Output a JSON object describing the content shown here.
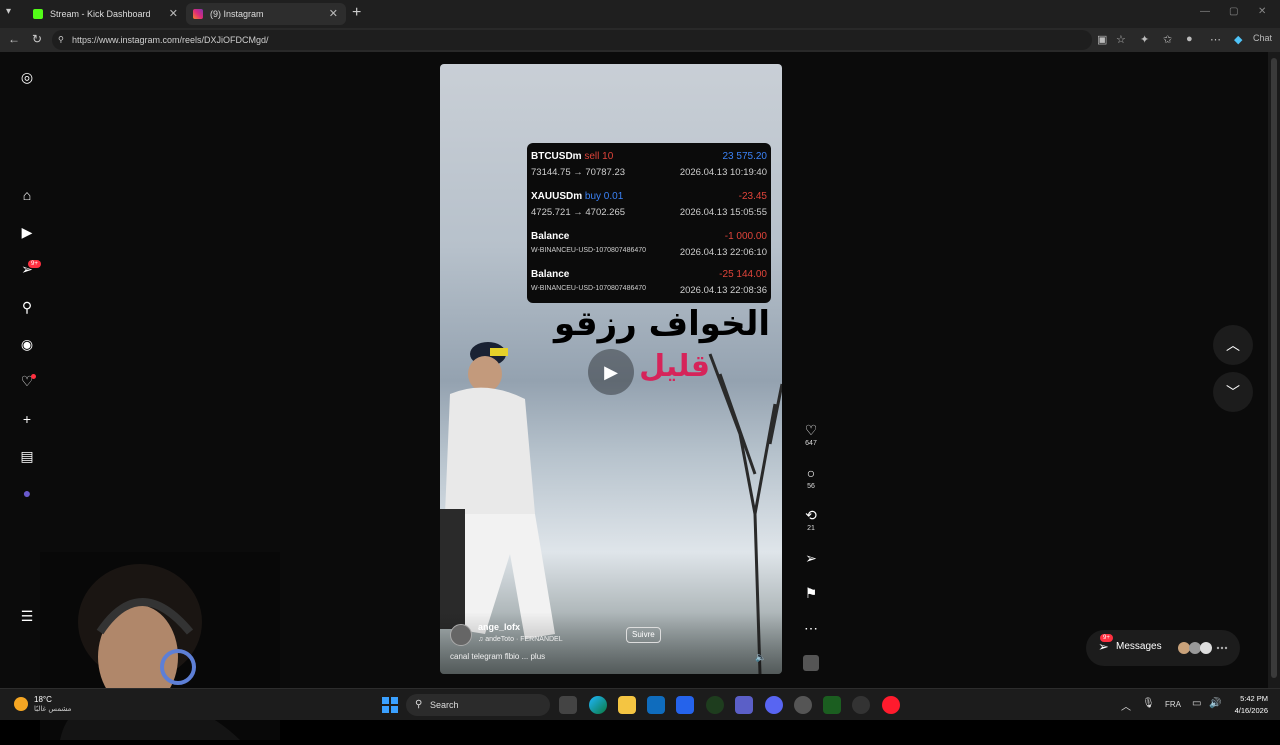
{
  "tabs": [
    {
      "title": "Stream - Kick Dashboard",
      "active": false,
      "favicon": "kick-icon",
      "color": "#53fc18"
    },
    {
      "title": "(9) Instagram",
      "active": true,
      "favicon": "instagram-icon",
      "color": "#e1306c"
    }
  ],
  "browser": {
    "url": "https://www.instagram.com/reels/DXJiOFDCMgd/",
    "chat_label": "Chat"
  },
  "sidebar": {
    "notification_badge": "9+",
    "items": [
      "instagram-logo",
      "home",
      "reels",
      "messages",
      "search",
      "explore",
      "notifications",
      "create",
      "dashboard",
      "profile",
      "more",
      "meta"
    ]
  },
  "reel": {
    "trades": [
      {
        "symbol": "BTCUSDm",
        "action": "sell 10",
        "action_type": "sell",
        "pnl": "23 575.20",
        "pnl_type": "pos",
        "prices": "73144.75 → 70787.23",
        "date": "2026.04.13 10:19:40"
      },
      {
        "symbol": "XAUUSDm",
        "action": "buy 0.01",
        "action_type": "buy",
        "pnl": "-23.45",
        "pnl_type": "neg",
        "prices": "4725.721 → 4702.265",
        "date": "2026.04.13 15:05:55"
      },
      {
        "symbol": "Balance",
        "action": "",
        "action_type": "",
        "pnl": "-1 000.00",
        "pnl_type": "neg",
        "prices": "W-BINANCEU-USD-1070807486470",
        "date": "2026.04.13 22:06:10"
      },
      {
        "symbol": "Balance",
        "action": "",
        "action_type": "",
        "pnl": "-25 144.00",
        "pnl_type": "neg",
        "prices": "W-BINANCEU-USD-1070807486470",
        "date": "2026.04.13 22:08:36"
      }
    ],
    "arabic_title": "الخواف رزقو",
    "arabic_sub": "قليل",
    "username": "ange_lofx",
    "audio": "andeToto · FERNANDEL",
    "follow_label": "Suivre",
    "caption": "canal telegram flbio ... plus"
  },
  "actions": {
    "likes": "647",
    "comments": "56",
    "reposts": "21"
  },
  "messages_label": "Messages",
  "messages_badge": "9+",
  "taskbar": {
    "temperature": "18°C",
    "weather_text": "مشمس غالبًا",
    "search_placeholder": "Search",
    "language": "FRA",
    "time": "5:42 PM",
    "date": "4/16/2026"
  },
  "colors": {
    "like": "#ff3040",
    "buy": "#3b82f6",
    "sell": "#e0443a",
    "arabic_sub": "#d6245a"
  }
}
